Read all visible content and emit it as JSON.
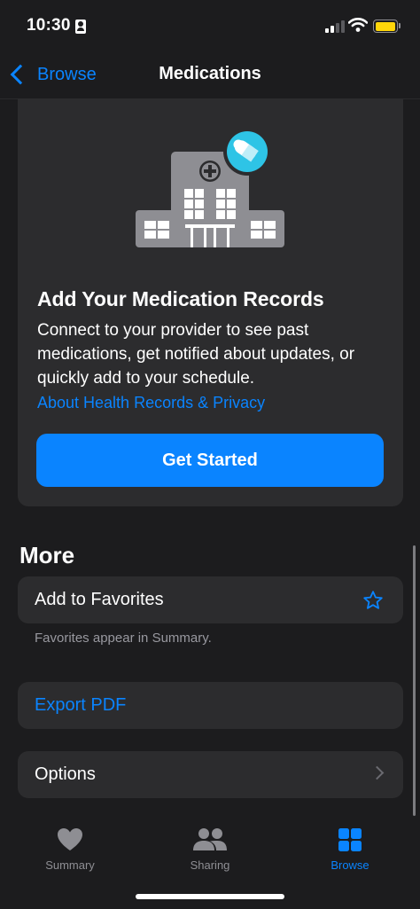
{
  "status_bar": {
    "time": "10:30"
  },
  "nav": {
    "back_label": "Browse",
    "title": "Medications"
  },
  "promo_card": {
    "title": "Add Your Medication Records",
    "body": "Connect to your provider to see past medications, get notified about updates, or quickly add to your schedule.",
    "link": "About Health Records & Privacy",
    "button": "Get Started"
  },
  "more": {
    "header": "More",
    "favorites_label": "Add to Favorites",
    "favorites_footnote": "Favorites appear in Summary.",
    "export_label": "Export PDF",
    "options_label": "Options"
  },
  "tab_bar": {
    "tabs": [
      {
        "label": "Summary",
        "icon": "heart-icon"
      },
      {
        "label": "Sharing",
        "icon": "people-icon"
      },
      {
        "label": "Browse",
        "icon": "grid-icon"
      }
    ],
    "active": "Browse"
  },
  "colors": {
    "accent": "#0a84ff",
    "background": "#1c1c1e",
    "card": "#2c2c2e",
    "secondary_text": "#98989f",
    "battery": "#ffd60a",
    "pill_badge": "#2ec4e6"
  }
}
